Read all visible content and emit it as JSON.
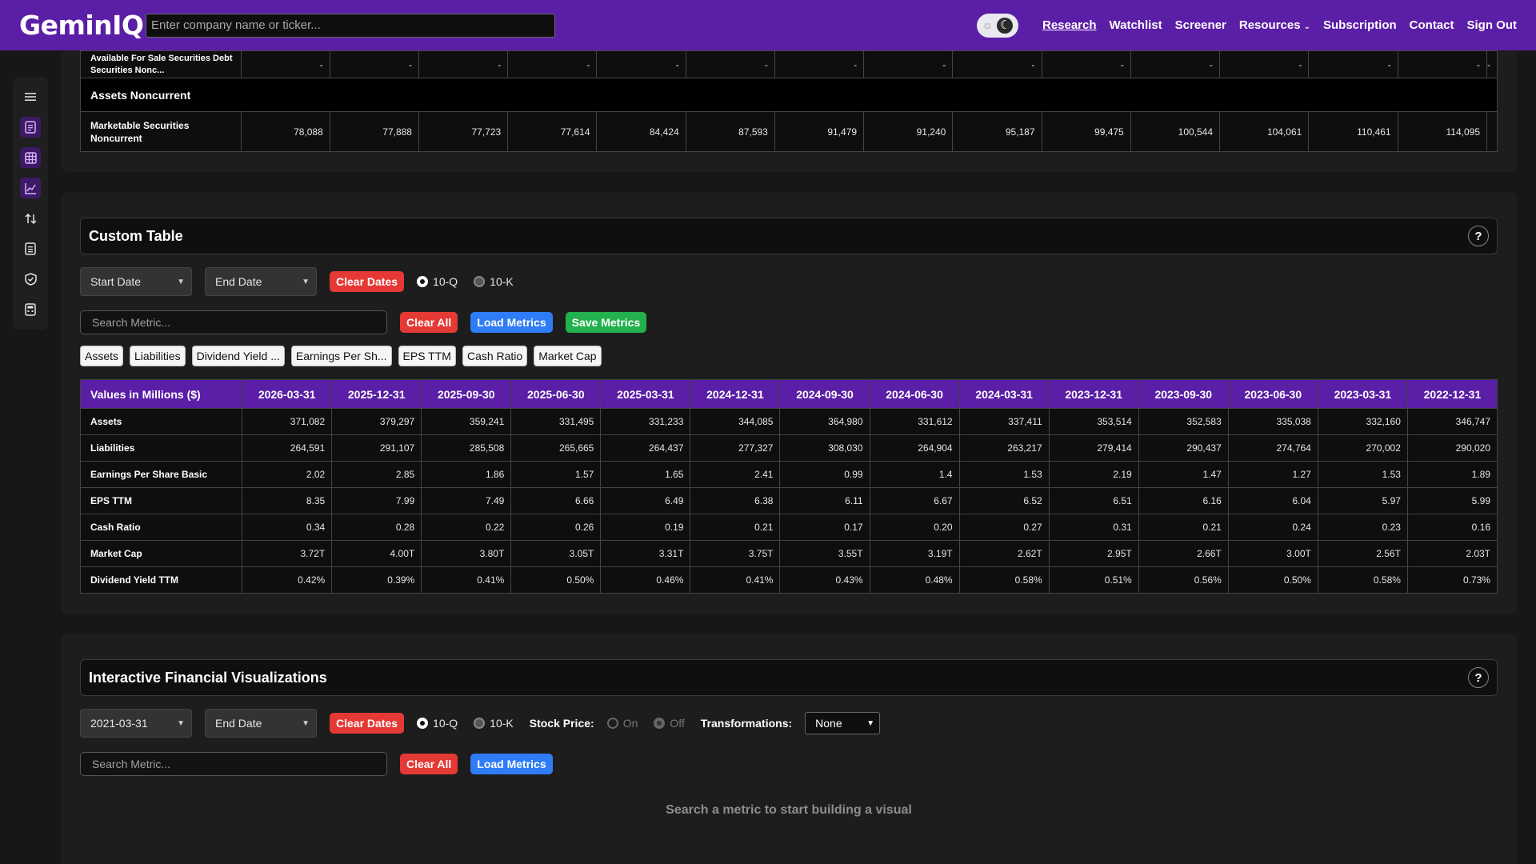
{
  "nav": {
    "logo": "GeminIQ",
    "search_placeholder": "Enter company name or ticker...",
    "links": [
      "Research",
      "Watchlist",
      "Screener",
      "Resources",
      "Subscription",
      "Contact",
      "Sign Out"
    ],
    "theme_icons": {
      "sun": "☼",
      "moon": "☾"
    }
  },
  "sidebar": {
    "icons": [
      "menu-icon",
      "document-icon",
      "table-icon",
      "chart-icon",
      "sort-icon",
      "report-icon",
      "shield-icon",
      "calculator-icon"
    ]
  },
  "top_table": {
    "rows": [
      {
        "label": "Available For Sale Securities Debt Securities Nonc...",
        "values": [
          "-",
          "-",
          "-",
          "-",
          "-",
          "-",
          "-",
          "-",
          "-",
          "-",
          "-",
          "-",
          "-",
          "-",
          "-"
        ]
      },
      {
        "label": "Assets Noncurrent",
        "section": true
      },
      {
        "label": "Marketable Securities Noncurrent",
        "values": [
          "78,088",
          "77,888",
          "77,723",
          "77,614",
          "84,424",
          "87,593",
          "91,479",
          "91,240",
          "95,187",
          "99,475",
          "100,544",
          "104,061",
          "110,461",
          "114,095"
        ]
      }
    ]
  },
  "custom_table": {
    "title": "Custom Table",
    "help": "?",
    "start_date": "Start Date",
    "end_date": "End Date",
    "clear_dates": "Clear Dates",
    "radio_10q": "10-Q",
    "radio_10k": "10-K",
    "search_placeholder": "Search Metric...",
    "clear_all": "Clear All",
    "load_metrics": "Load Metrics",
    "save_metrics": "Save Metrics",
    "chips": [
      "Assets",
      "Liabilities",
      "Dividend Yield ...",
      "Earnings Per Sh...",
      "EPS TTM",
      "Cash Ratio",
      "Market Cap"
    ],
    "header_label": "Values in Millions ($)",
    "columns": [
      "2026-03-31",
      "2025-12-31",
      "2025-09-30",
      "2025-06-30",
      "2025-03-31",
      "2024-12-31",
      "2024-09-30",
      "2024-06-30",
      "2024-03-31",
      "2023-12-31",
      "2023-09-30",
      "2023-06-30",
      "2023-03-31",
      "2022-12-31"
    ],
    "rows": [
      {
        "label": "Assets",
        "values": [
          "371,082",
          "379,297",
          "359,241",
          "331,495",
          "331,233",
          "344,085",
          "364,980",
          "331,612",
          "337,411",
          "353,514",
          "352,583",
          "335,038",
          "332,160",
          "346,747"
        ]
      },
      {
        "label": "Liabilities",
        "values": [
          "264,591",
          "291,107",
          "285,508",
          "265,665",
          "264,437",
          "277,327",
          "308,030",
          "264,904",
          "263,217",
          "279,414",
          "290,437",
          "274,764",
          "270,002",
          "290,020"
        ]
      },
      {
        "label": "Earnings Per Share Basic",
        "values": [
          "2.02",
          "2.85",
          "1.86",
          "1.57",
          "1.65",
          "2.41",
          "0.99",
          "1.4",
          "1.53",
          "2.19",
          "1.47",
          "1.27",
          "1.53",
          "1.89"
        ]
      },
      {
        "label": "EPS TTM",
        "values": [
          "8.35",
          "7.99",
          "7.49",
          "6.66",
          "6.49",
          "6.38",
          "6.11",
          "6.67",
          "6.52",
          "6.51",
          "6.16",
          "6.04",
          "5.97",
          "5.99"
        ]
      },
      {
        "label": "Cash Ratio",
        "values": [
          "0.34",
          "0.28",
          "0.22",
          "0.26",
          "0.19",
          "0.21",
          "0.17",
          "0.20",
          "0.27",
          "0.31",
          "0.21",
          "0.24",
          "0.23",
          "0.16"
        ]
      },
      {
        "label": "Market Cap",
        "values": [
          "3.72T",
          "4.00T",
          "3.80T",
          "3.05T",
          "3.31T",
          "3.75T",
          "3.55T",
          "3.19T",
          "2.62T",
          "2.95T",
          "2.66T",
          "3.00T",
          "2.56T",
          "2.03T"
        ]
      },
      {
        "label": "Dividend Yield TTM",
        "values": [
          "0.42%",
          "0.39%",
          "0.41%",
          "0.50%",
          "0.46%",
          "0.41%",
          "0.43%",
          "0.48%",
          "0.58%",
          "0.51%",
          "0.56%",
          "0.50%",
          "0.58%",
          "0.73%"
        ]
      }
    ]
  },
  "viz": {
    "title": "Interactive Financial Visualizations",
    "help": "?",
    "start_date": "2021-03-31",
    "end_date": "End Date",
    "clear_dates": "Clear Dates",
    "radio_10q": "10-Q",
    "radio_10k": "10-K",
    "stock_price_label": "Stock Price:",
    "on": "On",
    "off": "Off",
    "transform_label": "Transformations:",
    "transform_value": "None",
    "search_placeholder": "Search Metric...",
    "clear_all": "Clear All",
    "load_metrics": "Load Metrics",
    "empty_message": "Search a metric to start building a visual"
  }
}
